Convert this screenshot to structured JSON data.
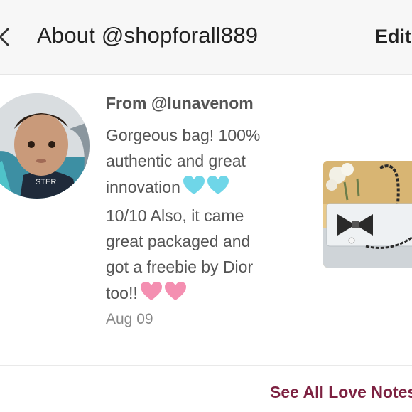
{
  "header": {
    "title": "About @shopforall889",
    "edit_label": "Edit",
    "back_icon": "chevron-left-icon"
  },
  "note": {
    "from": "From @lunavenom",
    "lines": [
      "Gorgeous bag! 100%",
      "authentic and great",
      "innovation",
      "10/10 Also, it came",
      "great packaged and",
      "got a freebie by Dior",
      "too!!"
    ],
    "date": "Aug 09",
    "emoji": {
      "line3": "light-blue-hearts",
      "line7": "pink-hearts"
    }
  },
  "footer": {
    "see_all_label": "See All Love Notes"
  },
  "colors": {
    "accent": "#7d2141",
    "text_primary": "#222222",
    "text_secondary": "#555555",
    "text_muted": "#888888",
    "header_bg": "#f7f7f7",
    "heart_blue": "#6fd6e8",
    "heart_pink": "#f48fb1"
  }
}
